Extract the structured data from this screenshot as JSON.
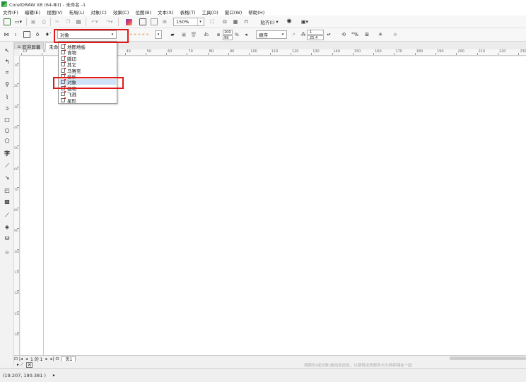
{
  "window": {
    "title": "CorelDRAW X8 (64-Bit) - 未命名 -1"
  },
  "menu": [
    "文件(F)",
    "编辑(E)",
    "视图(V)",
    "布局(L)",
    "对象(C)",
    "效果(C)",
    "位图(B)",
    "文本(X)",
    "表格(T)",
    "工具(O)",
    "窗口(W)",
    "帮助(H)"
  ],
  "toolbar1": {
    "zoom": "150%",
    "snap_label": "贴齐(I)"
  },
  "toolbar2": {
    "category_value": "对象",
    "size_w": "100",
    "size_h": "99",
    "percent": "%",
    "order": "顺序",
    "num1": "1",
    "num2": "25.4",
    "small_label": "≈ ≈ ≈ ≈ ≈"
  },
  "tabs": [
    "欢迎屏幕",
    "未命名"
  ],
  "dropdown": {
    "items": [
      {
        "label": "地图地板",
        "selected": false
      },
      {
        "label": "食物",
        "selected": false
      },
      {
        "label": "脚印",
        "selected": false
      },
      {
        "label": "其它",
        "selected": false
      },
      {
        "label": "马赛克",
        "selected": false
      },
      {
        "label": "音乐",
        "selected": false
      },
      {
        "label": "对象",
        "selected": true
      },
      {
        "label": "植物",
        "selected": false
      },
      {
        "label": "飞溅",
        "selected": false
      },
      {
        "label": "星形",
        "selected": false
      }
    ]
  },
  "ruler": {
    "h_labels": [
      "10",
      "0",
      "10",
      "20",
      "30",
      "40",
      "50",
      "60",
      "70",
      "80",
      "90",
      "100",
      "110",
      "120",
      "130",
      "140",
      "150",
      "160",
      "170",
      "180",
      "190",
      "200",
      "210",
      "220",
      "230",
      "240"
    ],
    "v_labels": [
      "10",
      "20",
      "30",
      "40",
      "50",
      "60",
      "70",
      "80",
      "90",
      "100",
      "110",
      "120",
      "130",
      "140",
      "150",
      "160",
      "170",
      "180",
      "190",
      "200",
      "210",
      "220",
      "230",
      "240",
      "250",
      "260",
      "270",
      "280"
    ]
  },
  "pagebar": {
    "page_info": "1 的 1",
    "page_tab": "页1"
  },
  "status": {
    "coords": "(19.207, 190.381 )",
    "hint": "将颜色(或对象)拖动至此处，以便将这些颜色与文档存储在一起"
  },
  "colors": {
    "highlight": "#e01818",
    "selected_row": "#cfe3f8"
  }
}
